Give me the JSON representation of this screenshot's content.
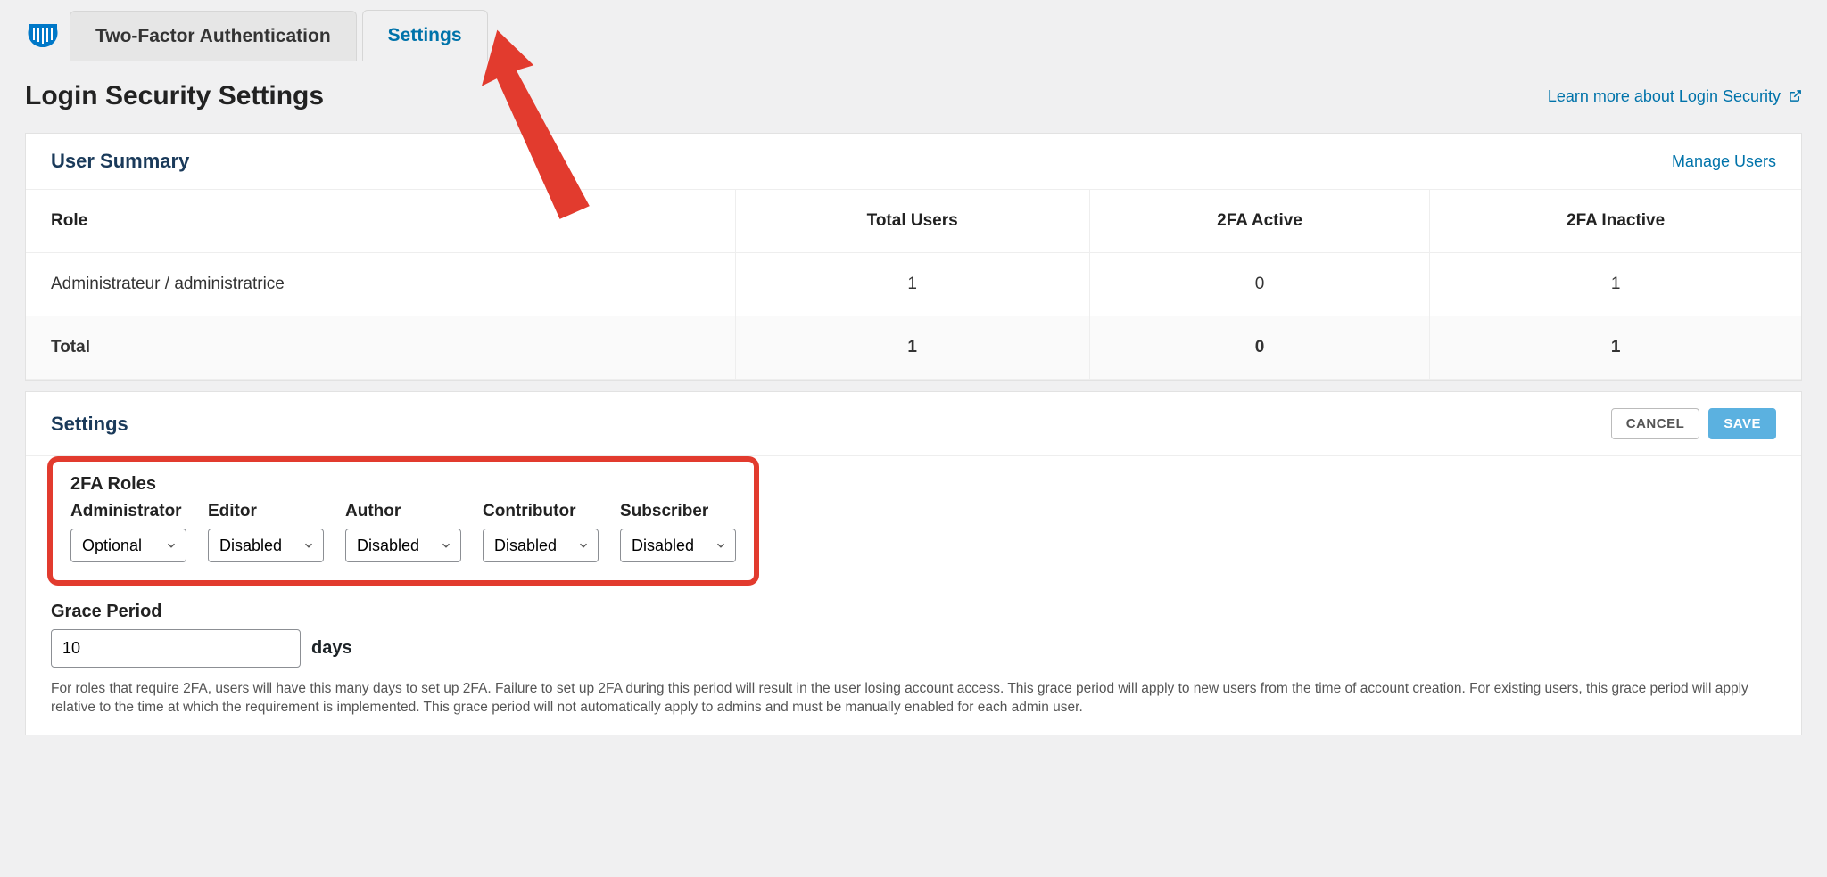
{
  "tabs": {
    "twofa": "Two-Factor Authentication",
    "settings": "Settings"
  },
  "header": {
    "title": "Login Security Settings",
    "learn_more": "Learn more about Login Security"
  },
  "user_summary": {
    "heading": "User Summary",
    "manage": "Manage Users",
    "cols": {
      "role": "Role",
      "total": "Total Users",
      "active": "2FA Active",
      "inactive": "2FA Inactive"
    },
    "rows": [
      {
        "role": "Administrateur / administratrice",
        "total": "1",
        "active": "0",
        "inactive": "1"
      },
      {
        "role": "Total",
        "total": "1",
        "active": "0",
        "inactive": "1"
      }
    ]
  },
  "settings_panel": {
    "heading": "Settings",
    "cancel": "CANCEL",
    "save": "SAVE",
    "roles_heading": "2FA Roles",
    "roles": [
      {
        "label": "Administrator",
        "value": "Optional"
      },
      {
        "label": "Editor",
        "value": "Disabled"
      },
      {
        "label": "Author",
        "value": "Disabled"
      },
      {
        "label": "Contributor",
        "value": "Disabled"
      },
      {
        "label": "Subscriber",
        "value": "Disabled"
      }
    ],
    "grace_heading": "Grace Period",
    "grace_value": "10",
    "grace_unit": "days",
    "help": "For roles that require 2FA, users will have this many days to set up 2FA. Failure to set up 2FA during this period will result in the user losing account access. This grace period will apply to new users from the time of account creation. For existing users, this grace period will apply relative to the time at which the requirement is implemented. This grace period will not automatically apply to admins and must be manually enabled for each admin user."
  }
}
